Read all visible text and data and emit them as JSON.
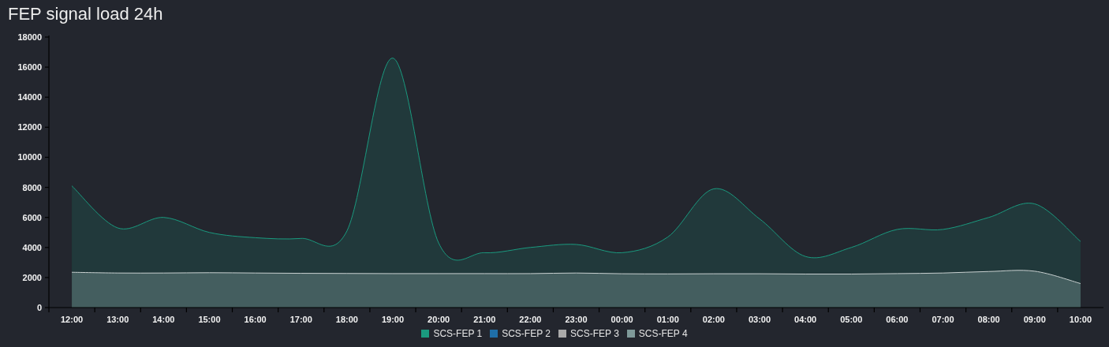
{
  "title": "FEP signal load 24h",
  "chart": {
    "chart_data": {
      "type": "area",
      "stacked": false,
      "categories": [
        "12:00",
        "13:00",
        "14:00",
        "15:00",
        "16:00",
        "17:00",
        "18:00",
        "19:00",
        "20:00",
        "21:00",
        "22:00",
        "23:00",
        "00:00",
        "01:00",
        "02:00",
        "03:00",
        "04:00",
        "05:00",
        "06:00",
        "07:00",
        "08:00",
        "09:00",
        "10:00"
      ],
      "ylim": [
        0,
        18000
      ],
      "yticks": [
        0,
        2000,
        4000,
        6000,
        8000,
        10000,
        12000,
        14000,
        16000,
        18000
      ],
      "series": [
        {
          "name": "SCS-FEP 1",
          "color": "#1a9a7f",
          "values": [
            8100,
            5300,
            6000,
            5000,
            4650,
            4600,
            5100,
            16600,
            4300,
            3650,
            4000,
            4200,
            3650,
            4700,
            7900,
            5900,
            3400,
            4000,
            5200,
            5200,
            6000,
            6900,
            4400
          ]
        },
        {
          "name": "SCS-FEP 2",
          "color": "#1f6fa8",
          "values": [
            null,
            null,
            null,
            null,
            null,
            null,
            null,
            null,
            null,
            null,
            null,
            null,
            null,
            null,
            null,
            null,
            null,
            null,
            null,
            null,
            null,
            null,
            null
          ]
        },
        {
          "name": "SCS-FEP 3",
          "color": "#aaaaaa",
          "values": [
            null,
            null,
            null,
            null,
            null,
            null,
            null,
            null,
            null,
            null,
            null,
            null,
            null,
            null,
            null,
            null,
            null,
            null,
            null,
            null,
            null,
            null,
            null
          ]
        },
        {
          "name": "SCS-FEP 4",
          "color": "#7f9a9a",
          "values": [
            2350,
            2300,
            2300,
            2320,
            2300,
            2280,
            2270,
            2260,
            2260,
            2260,
            2260,
            2300,
            2250,
            2240,
            2250,
            2250,
            2230,
            2230,
            2260,
            2300,
            2400,
            2420,
            1600
          ]
        }
      ]
    }
  }
}
